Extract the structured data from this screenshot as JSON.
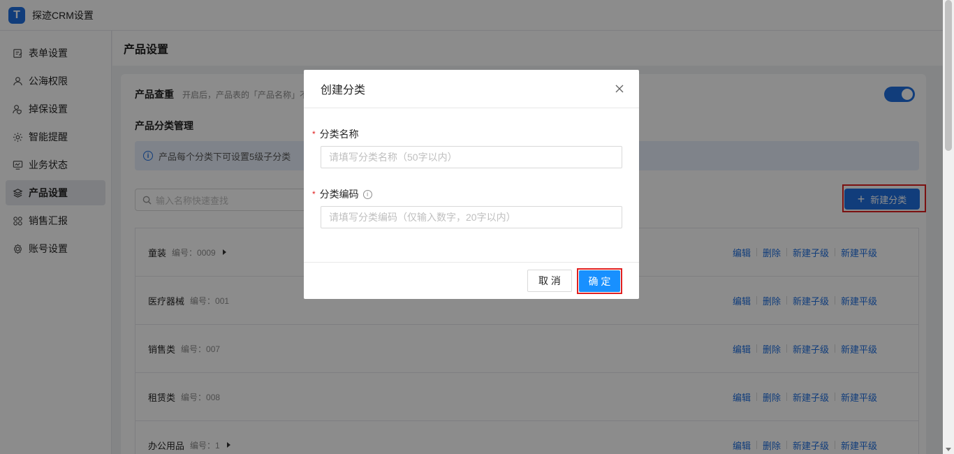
{
  "app": {
    "title": "探迹CRM设置",
    "logo_letter": "T"
  },
  "sidebar": {
    "items": [
      {
        "label": "表单设置",
        "icon": "form-edit-icon"
      },
      {
        "label": "公海权限",
        "icon": "user-icon"
      },
      {
        "label": "掉保设置",
        "icon": "user-shield-icon"
      },
      {
        "label": "智能提醒",
        "icon": "gear-icon"
      },
      {
        "label": "业务状态",
        "icon": "monitor-chart-icon"
      },
      {
        "label": "产品设置",
        "icon": "layers-icon",
        "active": true
      },
      {
        "label": "销售汇报",
        "icon": "grid-icon"
      },
      {
        "label": "账号设置",
        "icon": "settings-icon"
      }
    ]
  },
  "main": {
    "page_title": "产品设置",
    "duplicate": {
      "title": "产品查重",
      "desc": "开启后，产品表的「产品名称」不"
    },
    "category_section_title": "产品分类管理",
    "info_text": "产品每个分类下可设置5级子分类",
    "search_placeholder": "输入名称快速查找",
    "new_category_label": "新建分类",
    "rows": [
      {
        "name": "童装",
        "code": "编号：0009",
        "has_children": true
      },
      {
        "name": "医疗器械",
        "code": "编号：001",
        "has_children": false
      },
      {
        "name": "销售类",
        "code": "编号：007",
        "has_children": false
      },
      {
        "name": "租赁类",
        "code": "编号：008",
        "has_children": false
      },
      {
        "name": "办公用品",
        "code": "编号：1",
        "has_children": true
      }
    ],
    "row_actions": {
      "edit": "编辑",
      "delete": "删除",
      "add_child": "新建子级",
      "add_sibling": "新建平级"
    }
  },
  "modal": {
    "title": "创建分类",
    "name_label": "分类名称",
    "name_placeholder": "请填写分类名称（50字以内）",
    "code_label": "分类编码",
    "code_placeholder": "请填写分类编码（仅输入数字，20字以内）",
    "cancel_label": "取 消",
    "ok_label": "确 定"
  },
  "colors": {
    "primary": "#1f6fe0",
    "ok_button": "#1890ff",
    "highlight": "#e02020",
    "info_bg": "#e8effb"
  }
}
